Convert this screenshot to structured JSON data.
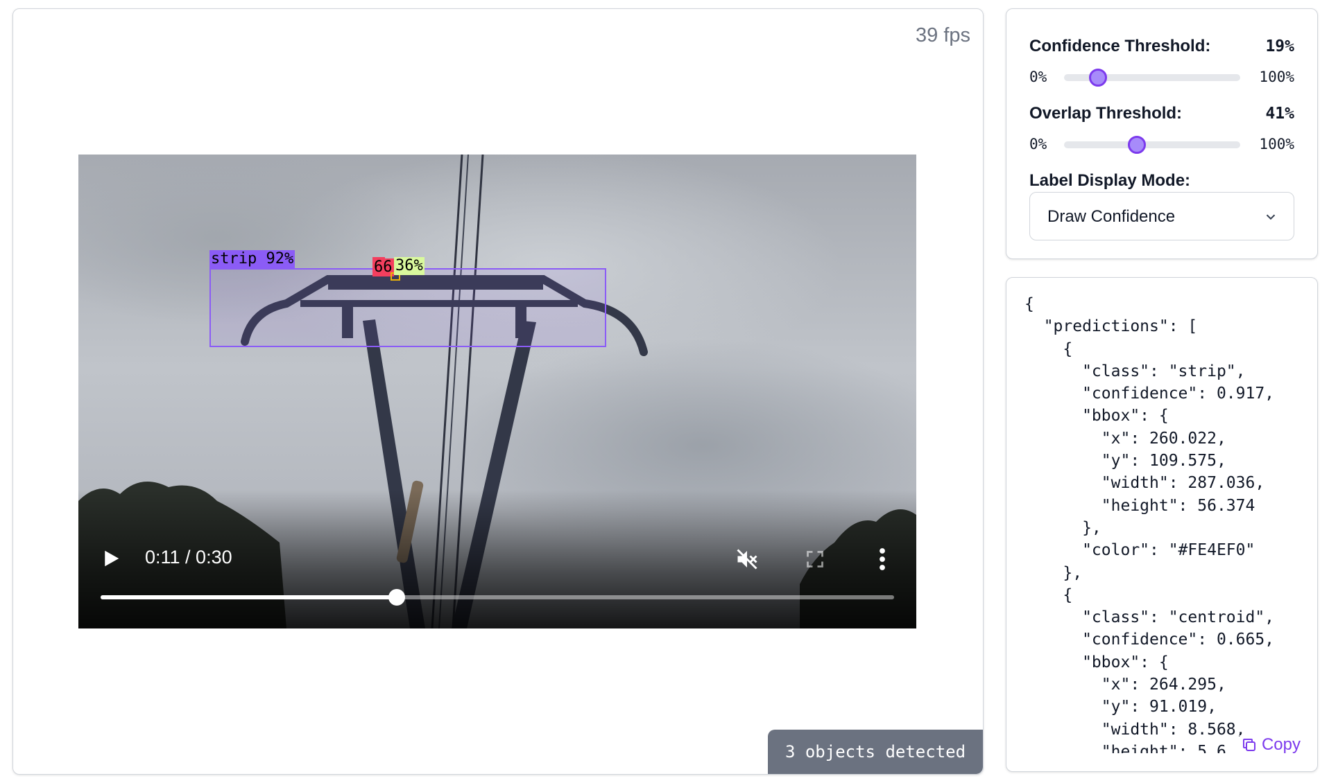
{
  "fps": "39 fps",
  "video": {
    "time": "0:11 / 0:30",
    "progress": 0.373,
    "play_icon": "play-icon",
    "mute_icon": "volume-muted-icon",
    "fullscreen_icon": "fullscreen-icon",
    "more_icon": "more-vertical-icon"
  },
  "detections": [
    {
      "label": "strip 92%",
      "class": "strip",
      "color": "#8B5CF6"
    },
    {
      "label": "66",
      "class": "centroid",
      "color": "#F43F5E"
    },
    {
      "label": "36%",
      "class": "",
      "color": "#D9F99D"
    }
  ],
  "status": {
    "detected": "3 objects detected"
  },
  "settings": {
    "confidence": {
      "label": "Confidence Threshold:",
      "value": "19%",
      "min": "0%",
      "max": "100%",
      "level": 0.19
    },
    "overlap": {
      "label": "Overlap Threshold:",
      "value": "41%",
      "min": "0%",
      "max": "100%",
      "level": 0.41
    },
    "label_mode": {
      "label": "Label Display Mode:",
      "selected": "Draw Confidence"
    },
    "accent": "#7C3AED"
  },
  "json_panel": {
    "text": "{\n  \"predictions\": [\n    {\n      \"class\": \"strip\",\n      \"confidence\": 0.917,\n      \"bbox\": {\n        \"x\": 260.022,\n        \"y\": 109.575,\n        \"width\": 287.036,\n        \"height\": 56.374\n      },\n      \"color\": \"#FE4EF0\"\n    },\n    {\n      \"class\": \"centroid\",\n      \"confidence\": 0.665,\n      \"bbox\": {\n        \"x\": 264.295,\n        \"y\": 91.019,\n        \"width\": 8.568,\n        \"height\": 5.6",
    "copy_label": "Copy"
  }
}
